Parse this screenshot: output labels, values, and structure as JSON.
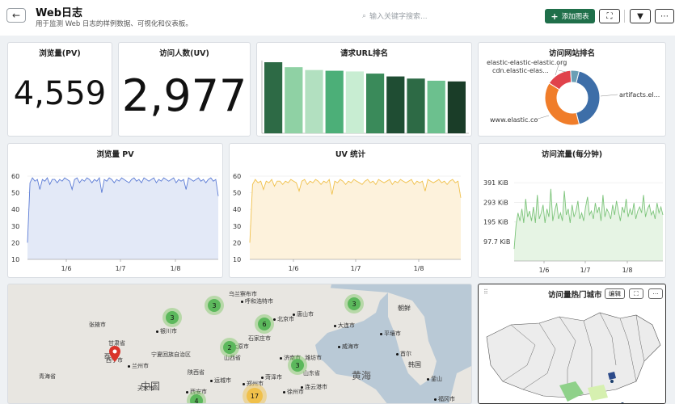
{
  "header": {
    "title": "Web日志",
    "subtitle": "用于监测 Web 日志的样例数据、可视化和仪表板。",
    "search_placeholder": "输入关键字搜索...",
    "add_label": "添加图表"
  },
  "pv_metric": {
    "title": "浏览量(PV)",
    "value": "4,559"
  },
  "uv_metric": {
    "title": "访问人数(UV)",
    "value": "2,977"
  },
  "url_rank": {
    "title": "请求URL排名",
    "chart_data": {
      "type": "bar",
      "values": [
        100,
        93,
        89,
        88,
        87,
        84,
        80,
        77,
        74,
        73
      ],
      "colors": [
        "#2d6a45",
        "#8fd1a4",
        "#b2e0c0",
        "#4caf78",
        "#c8edd2",
        "#3a8a5a",
        "#1f4d33",
        "#2d6a45",
        "#6cc08e",
        "#1a3d28"
      ],
      "ylim": [
        0,
        100
      ]
    }
  },
  "site_rank": {
    "title": "访问网站排名",
    "chart_data": {
      "type": "pie",
      "labels": [
        "artifacts.el...",
        "www.elastic.co",
        "elastic-elastic-elastic.org",
        "cdn.elastic-elas..."
      ],
      "values": [
        42,
        38,
        15,
        5
      ],
      "colors": [
        "#3d6ea8",
        "#f07d2a",
        "#e0424b",
        "#6b9fb5"
      ]
    }
  },
  "pv_chart": {
    "title": "浏览量 PV",
    "y_ticks": [
      "60",
      "50",
      "40",
      "30",
      "20",
      "10"
    ],
    "x_ticks": [
      "1/6",
      "1/7",
      "1/8"
    ],
    "chart_data": {
      "type": "area",
      "ylim": [
        10,
        60
      ],
      "color": "#5b7bd5",
      "fill": "#e3e9f7",
      "values": [
        20,
        56,
        59,
        57,
        58,
        52,
        58,
        57,
        59,
        55,
        58,
        58,
        56,
        58,
        57,
        59,
        58,
        57,
        52,
        58,
        59,
        56,
        58,
        57,
        59,
        58,
        56,
        58,
        57,
        59,
        50,
        58,
        57,
        59,
        58,
        56,
        58,
        57,
        59,
        58,
        57,
        56,
        58,
        59,
        57,
        58,
        56,
        59,
        58,
        57,
        58,
        59,
        56,
        58,
        57,
        59,
        58,
        57,
        58,
        59,
        56,
        58,
        57,
        58,
        52,
        59,
        58,
        57,
        58,
        59,
        57,
        58,
        56,
        58,
        59,
        57,
        58,
        48
      ]
    }
  },
  "uv_chart": {
    "title": "UV 统计",
    "y_ticks": [
      "60",
      "50",
      "40",
      "30",
      "20",
      "10"
    ],
    "x_ticks": [
      "1/6",
      "1/7",
      "1/8"
    ],
    "chart_data": {
      "type": "area",
      "ylim": [
        10,
        60
      ],
      "color": "#f0c04a",
      "fill": "#fdf2dc",
      "values": [
        20,
        55,
        58,
        56,
        57,
        52,
        57,
        56,
        58,
        54,
        57,
        57,
        55,
        57,
        56,
        58,
        57,
        56,
        51,
        57,
        58,
        55,
        57,
        56,
        58,
        57,
        55,
        57,
        56,
        58,
        49,
        57,
        56,
        58,
        57,
        55,
        57,
        56,
        58,
        57,
        56,
        55,
        57,
        58,
        56,
        57,
        55,
        58,
        57,
        56,
        57,
        58,
        55,
        57,
        56,
        58,
        57,
        56,
        57,
        58,
        55,
        57,
        56,
        57,
        51,
        58,
        57,
        56,
        57,
        58,
        56,
        57,
        55,
        57,
        58,
        56,
        57,
        47
      ]
    }
  },
  "traffic_chart": {
    "title": "访问流量(每分钟)",
    "y_ticks": [
      "391 KiB",
      "293 KiB",
      "195 KiB",
      "97.7 KiB"
    ],
    "x_ticks": [
      "1/6",
      "1/7",
      "1/8"
    ],
    "chart_data": {
      "type": "area",
      "ylim": [
        0,
        440
      ],
      "color": "#7cc47a",
      "fill": "#e6f4e4",
      "values": [
        60,
        180,
        240,
        200,
        260,
        190,
        310,
        220,
        250,
        200,
        270,
        190,
        330,
        210,
        240,
        280,
        190,
        260,
        220,
        360,
        200,
        250,
        290,
        210,
        240,
        200,
        350,
        230,
        260,
        190,
        280,
        220,
        250,
        300,
        210,
        240,
        200,
        270,
        320,
        230,
        250,
        210,
        290,
        240,
        270,
        200,
        330,
        220,
        260,
        240,
        210,
        280,
        230,
        300,
        250,
        200,
        270,
        240,
        310,
        220,
        260,
        230,
        290,
        210,
        250,
        270,
        240,
        330,
        220,
        260,
        280,
        230,
        250,
        210,
        290,
        240,
        270,
        230
      ]
    }
  },
  "map": {
    "cities": [
      {
        "name": "乌兰察布市"
      },
      {
        "name": "呼和浩特市"
      },
      {
        "name": "北京市"
      },
      {
        "name": "唐山市"
      },
      {
        "name": "朝鲜"
      },
      {
        "name": "张掖市"
      },
      {
        "name": "银川市"
      },
      {
        "name": "大连市"
      },
      {
        "name": "平壤市"
      },
      {
        "name": "石家庄市"
      },
      {
        "name": "甘肃省"
      },
      {
        "name": "山西省"
      },
      {
        "name": "宁夏回族自治区"
      },
      {
        "name": "西宁市"
      },
      {
        "name": "兰州市"
      },
      {
        "name": "济南市"
      },
      {
        "name": "威海市"
      },
      {
        "name": "首尔"
      },
      {
        "name": "潍坊市"
      },
      {
        "name": "太原市"
      },
      {
        "name": "韩国"
      },
      {
        "name": "青海省"
      },
      {
        "name": "陕西省"
      },
      {
        "name": "山东省"
      },
      {
        "name": "运城市"
      },
      {
        "name": "郑州市"
      },
      {
        "name": "菏泽市"
      },
      {
        "name": "中国"
      },
      {
        "name": "釜山"
      },
      {
        "name": "连云港市"
      },
      {
        "name": "天水市"
      },
      {
        "name": "西安市"
      },
      {
        "name": "徐州市"
      },
      {
        "name": "黄海"
      },
      {
        "name": "福冈市"
      },
      {
        "name": "西宁"
      }
    ],
    "clusters": [
      "3",
      "3",
      "3",
      "6",
      "2",
      "3",
      "17",
      "4"
    ]
  },
  "hot_city": {
    "title": "访问量热门城市",
    "edit_label": "编辑"
  }
}
